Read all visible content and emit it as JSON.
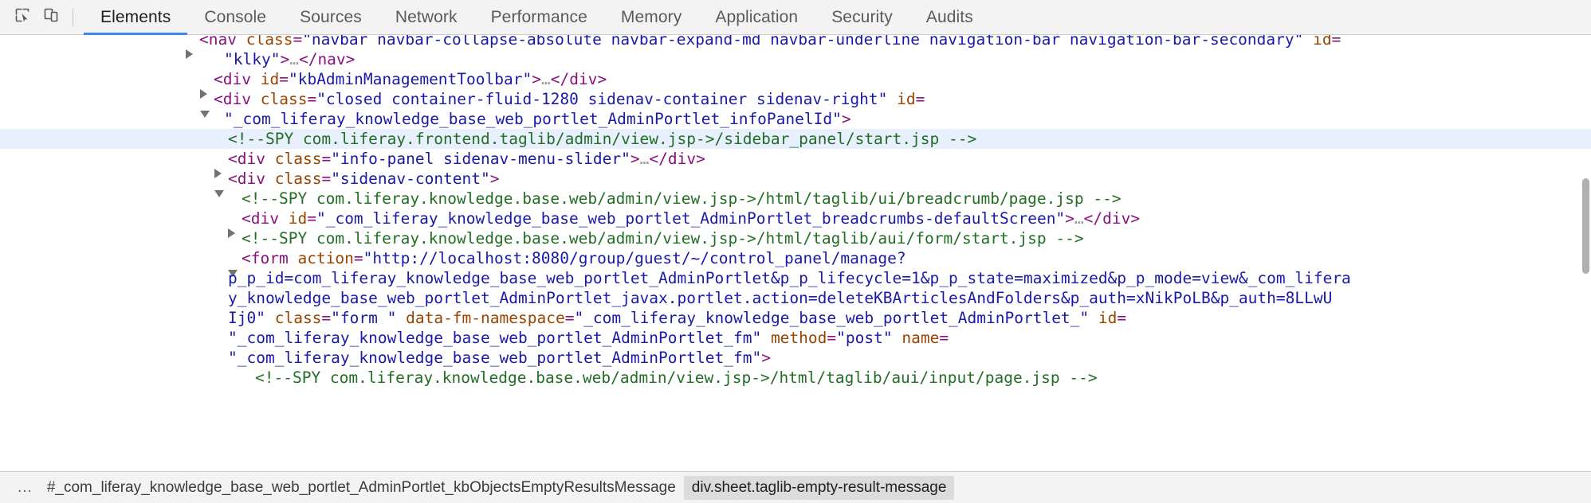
{
  "toolbar": {
    "icons": [
      {
        "name": "inspect-element-icon",
        "title": "Select an element in the page to inspect it"
      },
      {
        "name": "device-toolbar-icon",
        "title": "Toggle device toolbar"
      }
    ],
    "tabs": [
      {
        "label": "Elements",
        "active": true
      },
      {
        "label": "Console",
        "active": false
      },
      {
        "label": "Sources",
        "active": false
      },
      {
        "label": "Network",
        "active": false
      },
      {
        "label": "Performance",
        "active": false
      },
      {
        "label": "Memory",
        "active": false
      },
      {
        "label": "Application",
        "active": false
      },
      {
        "label": "Security",
        "active": false
      },
      {
        "label": "Audits",
        "active": false
      }
    ]
  },
  "dom_tree": {
    "rows": [
      {
        "id": "row-nav",
        "clipped_top": true,
        "twisty": "closed",
        "indent": 250,
        "selected": false,
        "segments": [
          {
            "t": "pun",
            "v": "<"
          },
          {
            "t": "tag",
            "v": "nav"
          },
          {
            "t": "txt",
            "v": " "
          },
          {
            "t": "attn",
            "v": "class"
          },
          {
            "t": "pun",
            "v": "="
          },
          {
            "t": "attv",
            "v": "\"navbar navbar-collapse-absolute navbar-expand-md navbar-underline navigation-bar navigation-bar-secondary\""
          },
          {
            "t": "txt",
            "v": " "
          },
          {
            "t": "attn",
            "v": "id"
          },
          {
            "t": "pun",
            "v": "="
          }
        ]
      },
      {
        "id": "row-nav-cont",
        "twisty": "none",
        "indent": 281,
        "selected": false,
        "segments": [
          {
            "t": "attv",
            "v": "\"klky\""
          },
          {
            "t": "pun",
            "v": ">"
          },
          {
            "t": "ell",
            "v": "…"
          },
          {
            "t": "pun",
            "v": "</"
          },
          {
            "t": "tag",
            "v": "nav"
          },
          {
            "t": "pun",
            "v": ">"
          }
        ]
      },
      {
        "id": "row-kbadmin",
        "twisty": "closed",
        "indent": 268,
        "selected": false,
        "segments": [
          {
            "t": "pun",
            "v": "<"
          },
          {
            "t": "tag",
            "v": "div"
          },
          {
            "t": "txt",
            "v": " "
          },
          {
            "t": "attn",
            "v": "id"
          },
          {
            "t": "pun",
            "v": "="
          },
          {
            "t": "attv",
            "v": "\"kbAdminManagementToolbar\""
          },
          {
            "t": "pun",
            "v": ">"
          },
          {
            "t": "ell",
            "v": "…"
          },
          {
            "t": "pun",
            "v": "</"
          },
          {
            "t": "tag",
            "v": "div"
          },
          {
            "t": "pun",
            "v": ">"
          }
        ]
      },
      {
        "id": "row-sidenav-container",
        "twisty": "open",
        "indent": 268,
        "selected": false,
        "segments": [
          {
            "t": "pun",
            "v": "<"
          },
          {
            "t": "tag",
            "v": "div"
          },
          {
            "t": "txt",
            "v": " "
          },
          {
            "t": "attn",
            "v": "class"
          },
          {
            "t": "pun",
            "v": "="
          },
          {
            "t": "attv",
            "v": "\"closed container-fluid-1280 sidenav-container sidenav-right\""
          },
          {
            "t": "txt",
            "v": " "
          },
          {
            "t": "attn",
            "v": "id"
          },
          {
            "t": "pun",
            "v": "="
          }
        ]
      },
      {
        "id": "row-sidenav-container-cont",
        "twisty": "none",
        "indent": 281,
        "selected": false,
        "segments": [
          {
            "t": "attv",
            "v": "\"_com_liferay_knowledge_base_web_portlet_AdminPortlet_infoPanelId\""
          },
          {
            "t": "pun",
            "v": ">"
          }
        ]
      },
      {
        "id": "row-spy-sidebar-panel",
        "twisty": "none",
        "indent": 286,
        "selected": true,
        "segments": [
          {
            "t": "cmt",
            "v": "<!--SPY com.liferay.frontend.taglib/admin/view.jsp->/sidebar_panel/start.jsp -->"
          }
        ]
      },
      {
        "id": "row-info-panel",
        "twisty": "closed",
        "indent": 286,
        "selected": false,
        "segments": [
          {
            "t": "pun",
            "v": "<"
          },
          {
            "t": "tag",
            "v": "div"
          },
          {
            "t": "txt",
            "v": " "
          },
          {
            "t": "attn",
            "v": "class"
          },
          {
            "t": "pun",
            "v": "="
          },
          {
            "t": "attv",
            "v": "\"info-panel sidenav-menu-slider\""
          },
          {
            "t": "pun",
            "v": ">"
          },
          {
            "t": "ell",
            "v": "…"
          },
          {
            "t": "pun",
            "v": "</"
          },
          {
            "t": "tag",
            "v": "div"
          },
          {
            "t": "pun",
            "v": ">"
          }
        ]
      },
      {
        "id": "row-sidenav-content",
        "twisty": "open",
        "indent": 286,
        "selected": false,
        "segments": [
          {
            "t": "pun",
            "v": "<"
          },
          {
            "t": "tag",
            "v": "div"
          },
          {
            "t": "txt",
            "v": " "
          },
          {
            "t": "attn",
            "v": "class"
          },
          {
            "t": "pun",
            "v": "="
          },
          {
            "t": "attv",
            "v": "\"sidenav-content\""
          },
          {
            "t": "pun",
            "v": ">"
          }
        ]
      },
      {
        "id": "row-spy-breadcrumb",
        "twisty": "none",
        "indent": 303,
        "selected": false,
        "segments": [
          {
            "t": "cmt",
            "v": "<!--SPY com.liferay.knowledge.base.web/admin/view.jsp->/html/taglib/ui/breadcrumb/page.jsp -->"
          }
        ]
      },
      {
        "id": "row-breadcrumbs-div",
        "twisty": "closed",
        "indent": 303,
        "selected": false,
        "segments": [
          {
            "t": "pun",
            "v": "<"
          },
          {
            "t": "tag",
            "v": "div"
          },
          {
            "t": "txt",
            "v": " "
          },
          {
            "t": "attn",
            "v": "id"
          },
          {
            "t": "pun",
            "v": "="
          },
          {
            "t": "attv",
            "v": "\"_com_liferay_knowledge_base_web_portlet_AdminPortlet_breadcrumbs-defaultScreen\""
          },
          {
            "t": "pun",
            "v": ">"
          },
          {
            "t": "ell",
            "v": "…"
          },
          {
            "t": "pun",
            "v": "</"
          },
          {
            "t": "tag",
            "v": "div"
          },
          {
            "t": "pun",
            "v": ">"
          }
        ]
      },
      {
        "id": "row-spy-form-start",
        "twisty": "none",
        "indent": 303,
        "selected": false,
        "segments": [
          {
            "t": "cmt",
            "v": "<!--SPY com.liferay.knowledge.base.web/admin/view.jsp->/html/taglib/aui/form/start.jsp -->"
          }
        ]
      },
      {
        "id": "row-form-open",
        "twisty": "open",
        "indent": 303,
        "selected": false,
        "segments": [
          {
            "t": "pun",
            "v": "<"
          },
          {
            "t": "tag",
            "v": "form"
          },
          {
            "t": "txt",
            "v": " "
          },
          {
            "t": "attn",
            "v": "action"
          },
          {
            "t": "pun",
            "v": "="
          },
          {
            "t": "attv",
            "v": "\"http://localhost:8080/group/guest/~/control_panel/manage?"
          }
        ]
      },
      {
        "id": "row-form-action-2",
        "twisty": "none",
        "indent": 286,
        "selected": false,
        "segments": [
          {
            "t": "attv",
            "v": "p_p_id=com_liferay_knowledge_base_web_portlet_AdminPortlet&p_p_lifecycle=1&p_p_state=maximized&p_p_mode=view&_com_lifera"
          }
        ]
      },
      {
        "id": "row-form-action-3",
        "twisty": "none",
        "indent": 286,
        "selected": false,
        "segments": [
          {
            "t": "attv",
            "v": "y_knowledge_base_web_portlet_AdminPortlet_javax.portlet.action=deleteKBArticlesAndFolders&p_auth=xNikPoLB&p_auth=8LLwU"
          }
        ]
      },
      {
        "id": "row-form-action-4",
        "twisty": "none",
        "indent": 286,
        "selected": false,
        "segments": [
          {
            "t": "attv",
            "v": "Ij0\""
          },
          {
            "t": "txt",
            "v": " "
          },
          {
            "t": "attn",
            "v": "class"
          },
          {
            "t": "pun",
            "v": "="
          },
          {
            "t": "attv",
            "v": "\"form \""
          },
          {
            "t": "txt",
            "v": " "
          },
          {
            "t": "attn",
            "v": "data-fm-namespace"
          },
          {
            "t": "pun",
            "v": "="
          },
          {
            "t": "attv",
            "v": "\"_com_liferay_knowledge_base_web_portlet_AdminPortlet_\""
          },
          {
            "t": "txt",
            "v": " "
          },
          {
            "t": "attn",
            "v": "id"
          },
          {
            "t": "pun",
            "v": "="
          }
        ]
      },
      {
        "id": "row-form-id",
        "twisty": "none",
        "indent": 286,
        "selected": false,
        "segments": [
          {
            "t": "attv",
            "v": "\"_com_liferay_knowledge_base_web_portlet_AdminPortlet_fm\""
          },
          {
            "t": "txt",
            "v": " "
          },
          {
            "t": "attn",
            "v": "method"
          },
          {
            "t": "pun",
            "v": "="
          },
          {
            "t": "attv",
            "v": "\"post\""
          },
          {
            "t": "txt",
            "v": " "
          },
          {
            "t": "attn",
            "v": "name"
          },
          {
            "t": "pun",
            "v": "="
          }
        ]
      },
      {
        "id": "row-form-name",
        "twisty": "none",
        "indent": 286,
        "selected": false,
        "segments": [
          {
            "t": "attv",
            "v": "\"_com_liferay_knowledge_base_web_portlet_AdminPortlet_fm\""
          },
          {
            "t": "pun",
            "v": ">"
          }
        ]
      },
      {
        "id": "row-spy-input-page",
        "twisty": "none",
        "clipped_bottom": true,
        "indent": 320,
        "selected": false,
        "segments": [
          {
            "t": "cmt",
            "v": "<!--SPY com.liferay.knowledge.base.web/admin/view.jsp->/html/taglib/aui/input/page.jsp -->"
          }
        ]
      }
    ]
  },
  "breadcrumb": {
    "overflow_label": "...",
    "items": [
      {
        "label": "#_com_liferay_knowledge_base_web_portlet_AdminPortlet_kbObjectsEmptyResultsMessage",
        "selected": false
      },
      {
        "label": "div.sheet.taglib-empty-result-message",
        "selected": true
      }
    ]
  },
  "colors": {
    "accent": "#4285f4",
    "selected_row": "#e8f0fe",
    "tag": "#881280",
    "attribute_name": "#994500",
    "attribute_value": "#1a1aa6",
    "comment": "#236e25",
    "toolbar_bg": "#f3f3f3"
  }
}
